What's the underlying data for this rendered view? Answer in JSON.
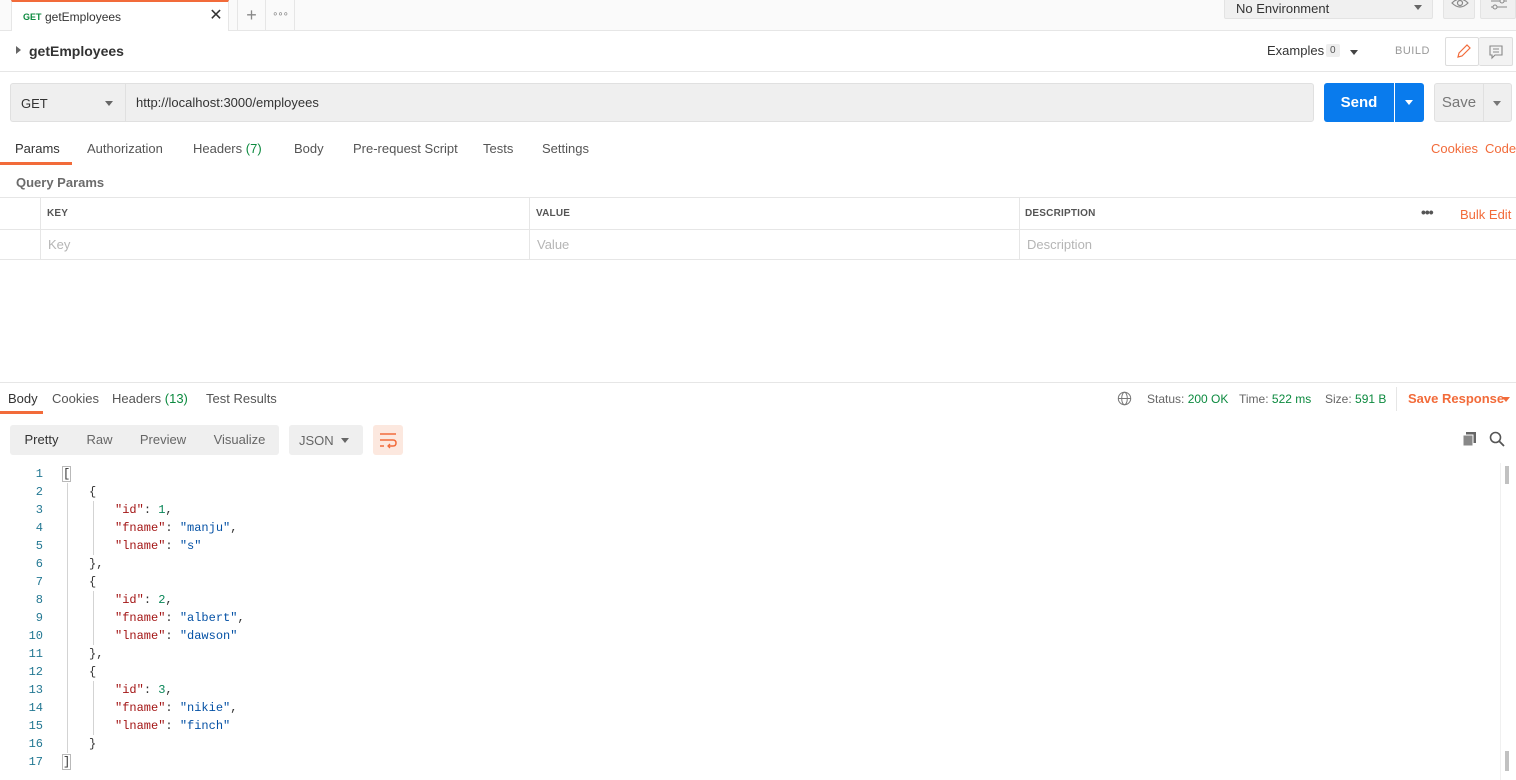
{
  "tab": {
    "method": "GET",
    "name": "getEmployees",
    "close": "✕"
  },
  "tabstrip": {
    "plus": "+",
    "more": "∘∘∘"
  },
  "environment": {
    "selected": "No Environment"
  },
  "request": {
    "name": "getEmployees",
    "examples_label": "Examples",
    "examples_count": "0",
    "build_label": "BUILD",
    "method": "GET",
    "url": "http://localhost:3000/employees",
    "send_label": "Send",
    "save_label": "Save"
  },
  "request_tabs": {
    "params": "Params",
    "authorization": "Authorization",
    "headers": "Headers",
    "headers_count": "(7)",
    "body": "Body",
    "prerequest": "Pre-request Script",
    "tests": "Tests",
    "settings": "Settings",
    "cookies": "Cookies",
    "code": "Code"
  },
  "query_params": {
    "title": "Query Params",
    "columns": [
      "KEY",
      "VALUE",
      "DESCRIPTION"
    ],
    "placeholders": [
      "Key",
      "Value",
      "Description"
    ],
    "bulk_edit": "Bulk Edit",
    "more": "•••"
  },
  "response_tabs": {
    "body": "Body",
    "cookies": "Cookies",
    "headers": "Headers",
    "headers_count": "(13)",
    "test_results": "Test Results"
  },
  "response_status": {
    "status_label": "Status:",
    "status_value": "200 OK",
    "time_label": "Time:",
    "time_value": "522 ms",
    "size_label": "Size:",
    "size_value": "591 B",
    "save_response": "Save Response"
  },
  "view_modes": [
    "Pretty",
    "Raw",
    "Preview",
    "Visualize"
  ],
  "format": "JSON",
  "code_lines": [
    {
      "n": "1",
      "indent": 0,
      "tokens": [
        [
          "p",
          "["
        ]
      ]
    },
    {
      "n": "2",
      "indent": 1,
      "tokens": [
        [
          "p",
          "{"
        ]
      ]
    },
    {
      "n": "3",
      "indent": 2,
      "tokens": [
        [
          "k",
          "\"id\""
        ],
        [
          "p",
          ": "
        ],
        [
          "n",
          "1"
        ],
        [
          "p",
          ","
        ]
      ]
    },
    {
      "n": "4",
      "indent": 2,
      "tokens": [
        [
          "k",
          "\"fname\""
        ],
        [
          "p",
          ": "
        ],
        [
          "s",
          "\"manju\""
        ],
        [
          "p",
          ","
        ]
      ]
    },
    {
      "n": "5",
      "indent": 2,
      "tokens": [
        [
          "k",
          "\"lname\""
        ],
        [
          "p",
          ": "
        ],
        [
          "s",
          "\"s\""
        ]
      ]
    },
    {
      "n": "6",
      "indent": 1,
      "tokens": [
        [
          "p",
          "},"
        ]
      ]
    },
    {
      "n": "7",
      "indent": 1,
      "tokens": [
        [
          "p",
          "{"
        ]
      ]
    },
    {
      "n": "8",
      "indent": 2,
      "tokens": [
        [
          "k",
          "\"id\""
        ],
        [
          "p",
          ": "
        ],
        [
          "n",
          "2"
        ],
        [
          "p",
          ","
        ]
      ]
    },
    {
      "n": "9",
      "indent": 2,
      "tokens": [
        [
          "k",
          "\"fname\""
        ],
        [
          "p",
          ": "
        ],
        [
          "s",
          "\"albert\""
        ],
        [
          "p",
          ","
        ]
      ]
    },
    {
      "n": "10",
      "indent": 2,
      "tokens": [
        [
          "k",
          "\"lname\""
        ],
        [
          "p",
          ": "
        ],
        [
          "s",
          "\"dawson\""
        ]
      ]
    },
    {
      "n": "11",
      "indent": 1,
      "tokens": [
        [
          "p",
          "},"
        ]
      ]
    },
    {
      "n": "12",
      "indent": 1,
      "tokens": [
        [
          "p",
          "{"
        ]
      ]
    },
    {
      "n": "13",
      "indent": 2,
      "tokens": [
        [
          "k",
          "\"id\""
        ],
        [
          "p",
          ": "
        ],
        [
          "n",
          "3"
        ],
        [
          "p",
          ","
        ]
      ]
    },
    {
      "n": "14",
      "indent": 2,
      "tokens": [
        [
          "k",
          "\"fname\""
        ],
        [
          "p",
          ": "
        ],
        [
          "s",
          "\"nikie\""
        ],
        [
          "p",
          ","
        ]
      ]
    },
    {
      "n": "15",
      "indent": 2,
      "tokens": [
        [
          "k",
          "\"lname\""
        ],
        [
          "p",
          ": "
        ],
        [
          "s",
          "\"finch\""
        ]
      ]
    },
    {
      "n": "16",
      "indent": 1,
      "tokens": [
        [
          "p",
          "}"
        ]
      ]
    },
    {
      "n": "17",
      "indent": 0,
      "tokens": [
        [
          "p",
          "]"
        ]
      ]
    }
  ],
  "colors": {
    "accent": "#f26b3a",
    "send": "#097bed",
    "success": "#0c8a3f"
  }
}
